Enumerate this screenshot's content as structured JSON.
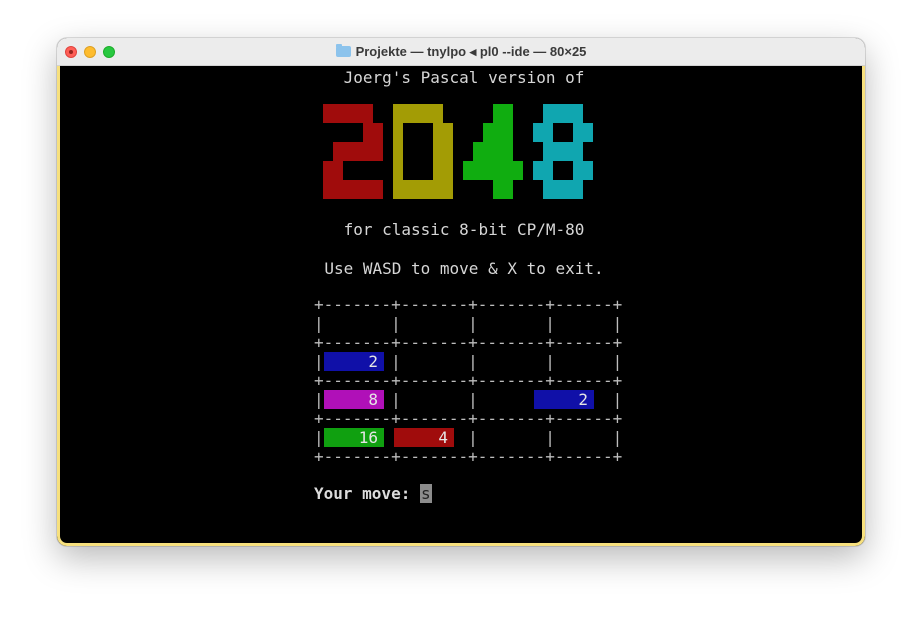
{
  "window": {
    "title": "Projekte — tnylpo ◂ pl0 --ide — 80×25",
    "title_icon": "folder-icon"
  },
  "game": {
    "heading": "Joerg's Pascal version of",
    "logo_text": "2048",
    "logo_colors": [
      "#a00c0c",
      "#a39c05",
      "#10ad10",
      "#10a6b0"
    ],
    "subtitle": "for classic 8-bit CP/M-80",
    "instructions": "Use WASD to move & X to exit.",
    "board_text": "+-------+-------+-------+------+\n|       |       |       |      |\n+-------+-------+-------+------+\n|       |       |       |      |\n+-------+-------+-------+------+\n|       |       |       |      |\n+-------+-------+-------+------+\n|       |       |       |      |\n+-------+-------+-------+------+",
    "tiles": [
      {
        "row": 1,
        "col": 0,
        "value": "2",
        "color": "#1010a8"
      },
      {
        "row": 2,
        "col": 0,
        "value": "8",
        "color": "#b010b8"
      },
      {
        "row": 2,
        "col": 3,
        "value": "2",
        "color": "#1010a8"
      },
      {
        "row": 3,
        "col": 0,
        "value": "16",
        "color": "#10a010"
      },
      {
        "row": 3,
        "col": 1,
        "value": "4",
        "color": "#a00c0c"
      }
    ],
    "prompt_label": "Your move: ",
    "input_value": "s"
  }
}
